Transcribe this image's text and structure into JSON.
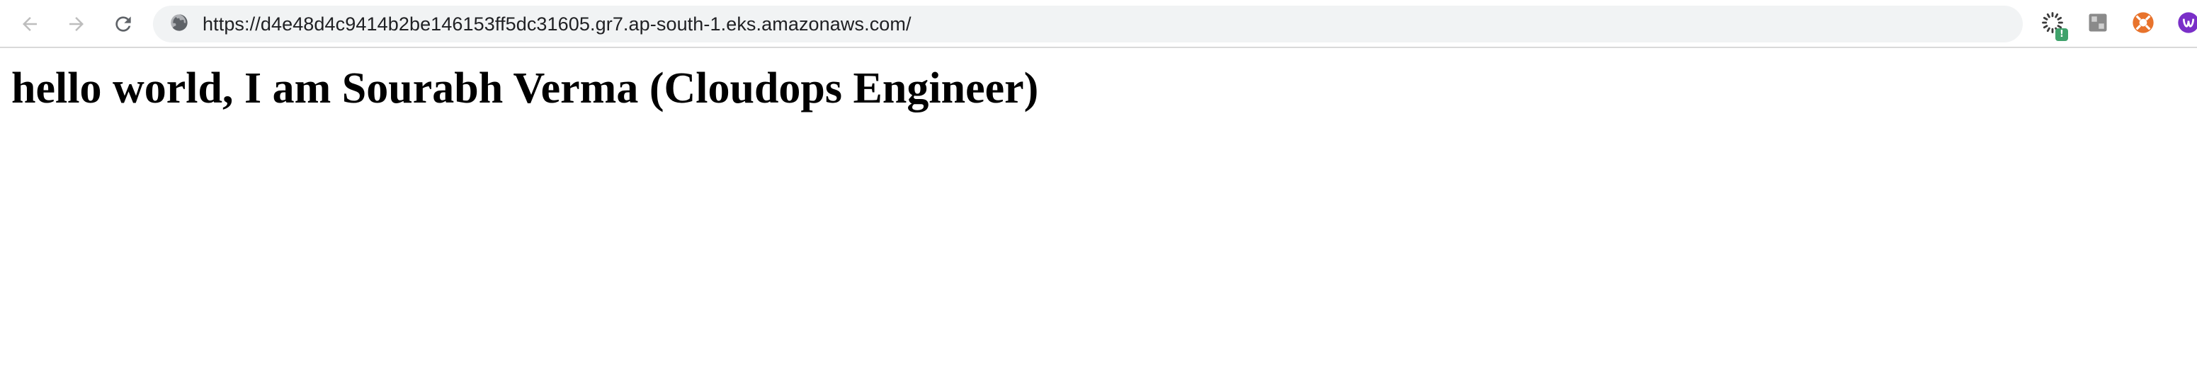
{
  "browser": {
    "url": "https://d4e48d4c9414b2be146153ff5dc31605.gr7.ap-south-1.eks.amazonaws.com/",
    "icons": {
      "back": "back-arrow-icon",
      "forward": "forward-arrow-icon",
      "reload": "reload-icon",
      "site_info": "site-info-icon"
    },
    "extensions": [
      {
        "name": "extension-spinner-icon",
        "badge": "!"
      },
      {
        "name": "extension-grey-square-icon"
      },
      {
        "name": "extension-orange-circle-icon"
      },
      {
        "name": "extension-purple-circle-icon"
      }
    ],
    "colors": {
      "omnibox_bg": "#f1f3f4",
      "disabled_icon": "#bdbdbd",
      "active_icon": "#5f6368"
    }
  },
  "page": {
    "heading": "hello world, I am Sourabh Verma (Cloudops Engineer)"
  }
}
